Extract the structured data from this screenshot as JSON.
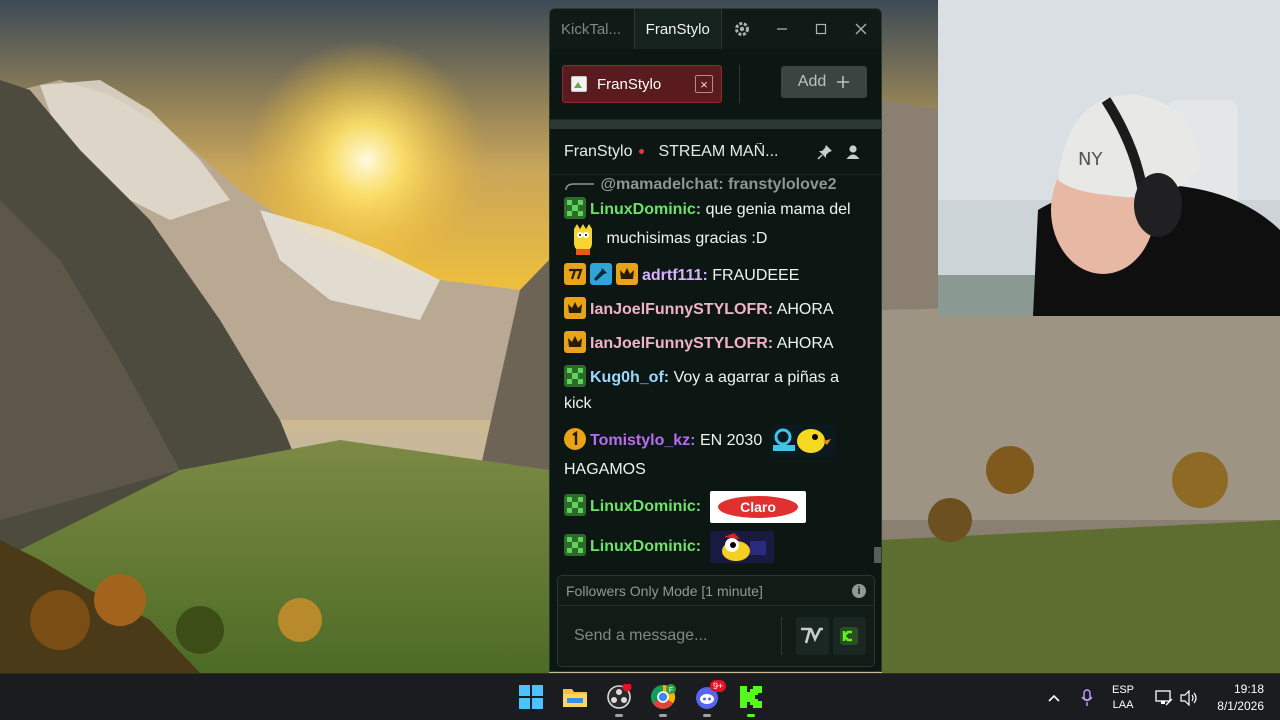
{
  "window": {
    "app_tab": "KickTal...",
    "channel_tab": "FranStylo"
  },
  "channels": {
    "open_tab": "FranStylo",
    "add_label": "Add"
  },
  "stream": {
    "channel": "FranStylo",
    "title": "STREAM MAÑ..."
  },
  "messages": [
    {
      "reply": "@mamadelchat: franstylolove2"
    },
    {
      "user": "LinuxDominic:",
      "text_before": "que genia mama del",
      "text_after": "muchisimas gracias :D",
      "color": "#6de26a"
    },
    {
      "user": "adrtf111:",
      "text": "FRAUDEEE",
      "color": "#d9b3ff"
    },
    {
      "user": "IanJoelFunnySTYLOFR:",
      "text": "AHORA",
      "color": "#f2b3c6"
    },
    {
      "user": "IanJoelFunnySTYLOFR:",
      "text": "AHORA",
      "color": "#f2b3c6"
    },
    {
      "user": "Kug0h_of:",
      "text": "Voy a agarrar a piñas a kick",
      "color": "#9ed8ff"
    },
    {
      "user": "Tomistylo_kz:",
      "text_before": "EN 2030",
      "text_after": "HAGAMOS",
      "color": "#b96cf2"
    },
    {
      "user": "LinuxDominic:",
      "emote_text": "Claro",
      "color": "#6de26a"
    },
    {
      "user": "LinuxDominic:",
      "color": "#6de26a"
    }
  ],
  "input": {
    "mode_note": "Followers Only Mode [1 minute]",
    "placeholder": "Send a message..."
  },
  "taskbar": {
    "lang_top": "ESP",
    "lang_bottom": "LAA",
    "time": "19:18",
    "date": "8/1/2026",
    "discord_badge": "9+"
  },
  "colors": {
    "kick_green": "#53fc18",
    "tab_red": "#5a1b1f",
    "chat_bg": "#0c1612"
  }
}
